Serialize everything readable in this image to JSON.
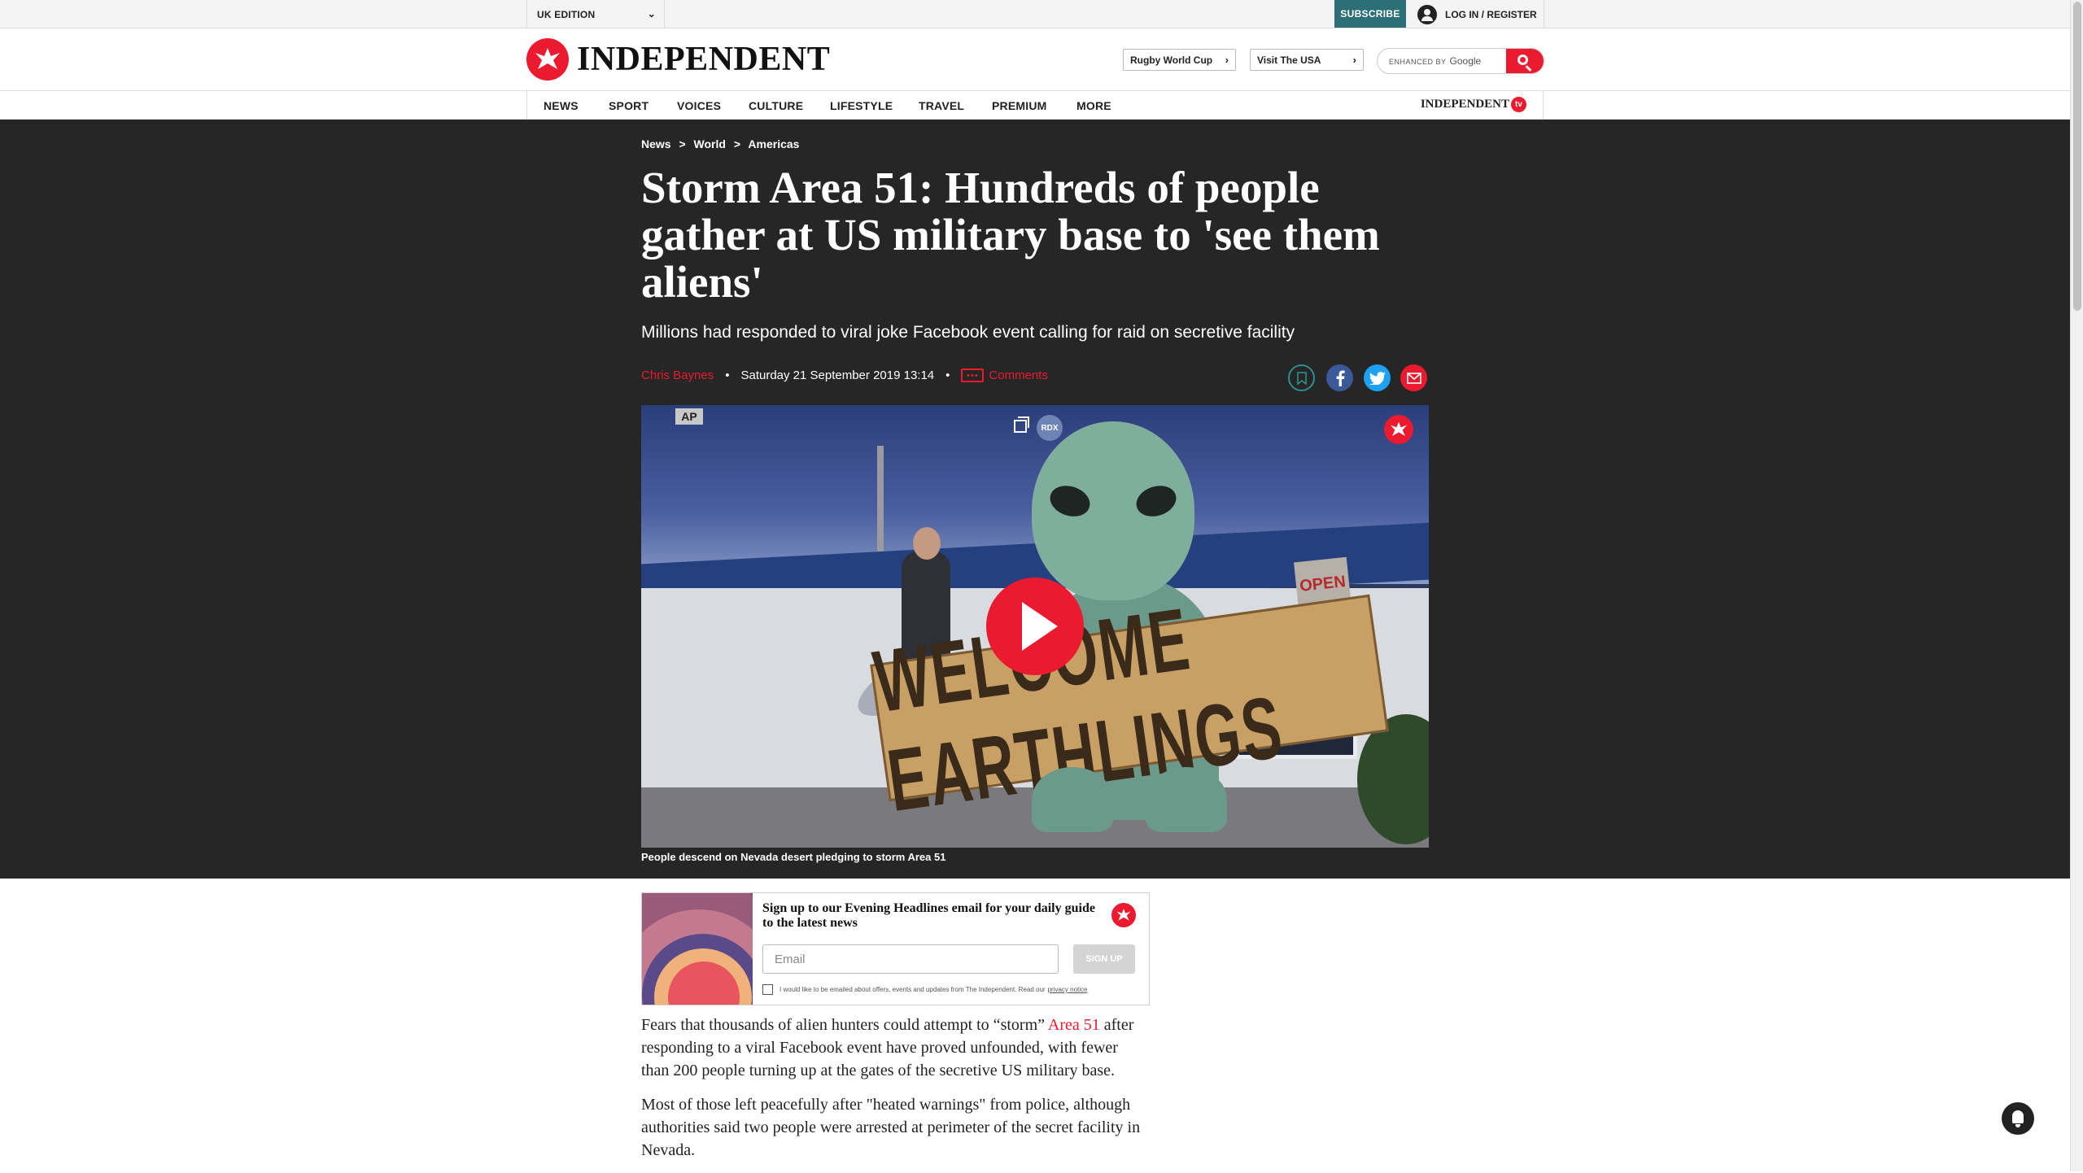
{
  "topbar": {
    "edition": "UK EDITION",
    "subscribe": "SUBSCRIBE",
    "login": "LOG IN / REGISTER"
  },
  "masthead": {
    "logo_text": "INDEPENDENT",
    "promo1": "Rugby World Cup",
    "promo2": "Visit The USA",
    "search_small": "ENHANCED BY",
    "search_brand": "Google"
  },
  "nav": {
    "items": [
      "NEWS",
      "SPORT",
      "VOICES",
      "CULTURE",
      "LIFESTYLE",
      "TRAVEL",
      "PREMIUM",
      "MORE"
    ],
    "tv_logo_text": "INDEPENDENT",
    "tv_badge": "tv"
  },
  "article": {
    "breadcrumb": [
      "News",
      ">",
      "World",
      ">",
      "Americas"
    ],
    "headline": "Storm Area 51: Hundreds of people gather at US military base to 'see them aliens'",
    "standfirst": "Millions had responded to viral joke Facebook event calling for raid on secretive facility",
    "author": "Chris Baynes",
    "date": "Saturday 21 September 2019 13:14",
    "comments_label": "Comments",
    "comments_icon": "•••",
    "share_icons": [
      "bookmark-icon",
      "facebook-icon",
      "twitter-icon",
      "email-icon"
    ],
    "video": {
      "ap_label": "AP",
      "rdx_label": "RDX",
      "sign_text": "WELCOME EARTHLINGS",
      "open_sign": "OPEN",
      "caption": "People descend on Nevada desert pledging to storm Area 51"
    },
    "body": [
      {
        "before": "Fears that thousands of alien hunters could attempt to “storm” ",
        "link": "Area 51",
        "after": " after responding to a viral Facebook event have proved unfounded, with fewer than 200 people turning up at the gates of the secretive US military base."
      },
      {
        "text": "Most of those left peacefully after \"heated warnings\" from police, although authorities said two people were arrested at perimeter of the secret facility in Nevada."
      }
    ]
  },
  "newsletter": {
    "title": "Sign up to our Evening Headlines email for your daily guide to the latest news",
    "email_placeholder": "Email",
    "signup": "SIGN UP",
    "consent": "I would like to be emailed about offers, events and updates from The Independent. Read our",
    "privacy": "privacy notice"
  },
  "colors": {
    "brand_red": "#ec1a2e",
    "subscribe_teal": "#2d6f77",
    "hero_bg": "#262626"
  }
}
